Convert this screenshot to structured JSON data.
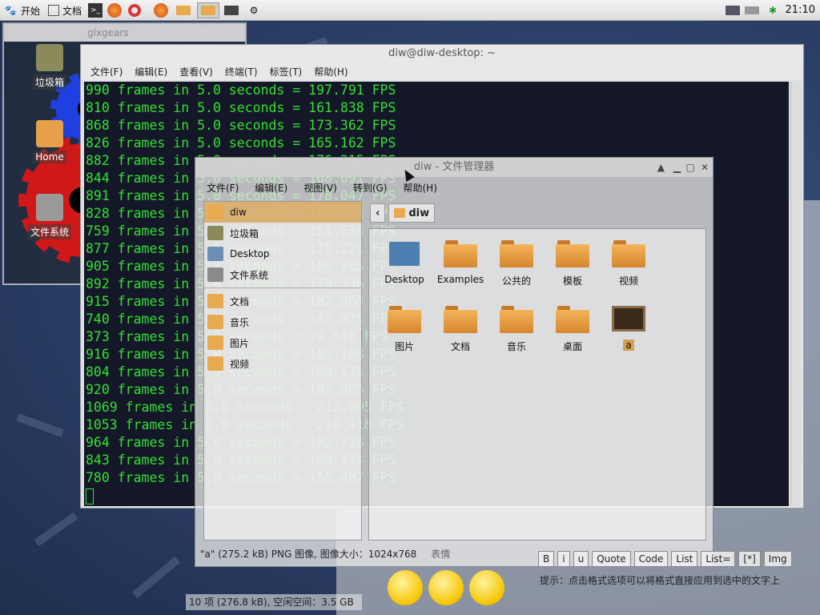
{
  "top_panel": {
    "start_label": "开始",
    "docs_label": "文档",
    "clock": "21:10"
  },
  "glxgears": {
    "title": "glxgears"
  },
  "desktop_icons": [
    {
      "label": "垃圾箱"
    },
    {
      "label": "Home"
    },
    {
      "label": "文件系统"
    }
  ],
  "terminal": {
    "title": "diw@diw-desktop: ~",
    "menu": [
      "文件(F)",
      "编辑(E)",
      "查看(V)",
      "终端(T)",
      "标签(T)",
      "帮助(H)"
    ],
    "lines": [
      "990 frames in 5.0 seconds = 197.791 FPS",
      "810 frames in 5.0 seconds = 161.838 FPS",
      "868 frames in 5.0 seconds = 173.362 FPS",
      "826 frames in 5.0 seconds = 165.162 FPS",
      "882 frames in 5.0 seconds = 176.215 FPS",
      "844 frames in 5.0 seconds = 168.691 FPS",
      "891 frames in 5.0 seconds = 178.047 FPS",
      "828 frames in 5.0 seconds = 165.532 FPS",
      "759 frames in 5.0 seconds = 151.638 FPS",
      "877 frames in 5.0 seconds = 175.221 FPS",
      "905 frames in 5.0 seconds = 180.985 FPS",
      "892 frames in 5.0 seconds = 178.336 FPS",
      "915 frames in 5.0 seconds = 182.863 FPS",
      "740 frames in 5.0 seconds = 147.875 FPS",
      "373 frames in 5.0 seconds = 74.548 FPS",
      "916 frames in 5.0 seconds = 183.108 FPS",
      "804 frames in 5.0 seconds = 160.575 FPS",
      "920 frames in 5.0 seconds = 183.985 FPS",
      "1069 frames in 5.0 seconds = 213.605 FPS",
      "1053 frames in 5.0 seconds = 210.418 FPS",
      "964 frames in 5.0 seconds = 192.738 FPS",
      "843 frames in 5.0 seconds = 168.474 FPS",
      "780 frames in 5.0 seconds = 155.487 FPS"
    ]
  },
  "file_manager": {
    "title": "diw - 文件管理器",
    "menu": [
      "文件(F)",
      "编辑(E)",
      "视图(V)",
      "转到(G)",
      "帮助(H)"
    ],
    "sidebar": [
      "diw",
      "垃圾箱",
      "Desktop",
      "文件系统",
      "文档",
      "音乐",
      "图片",
      "视频"
    ],
    "path_current": "diw",
    "files": [
      "Desktop",
      "Examples",
      "公共的",
      "模板",
      "视频",
      "图片",
      "文档",
      "音乐",
      "桌面",
      "a"
    ],
    "status_selected": "\"a\" (275.2 kB) PNG 图像, 图像大小：1024x768",
    "status_extra": "表情",
    "status_count": "10 项 (276.8 kB), 空闲空间：3.5 GB"
  },
  "forum": {
    "buttons": [
      "B",
      "i",
      "u",
      "Quote",
      "Code",
      "List",
      "List=",
      "[*]",
      "Img"
    ],
    "hint": "提示：点击格式选项可以将格式直接应用到选中的文字上"
  }
}
